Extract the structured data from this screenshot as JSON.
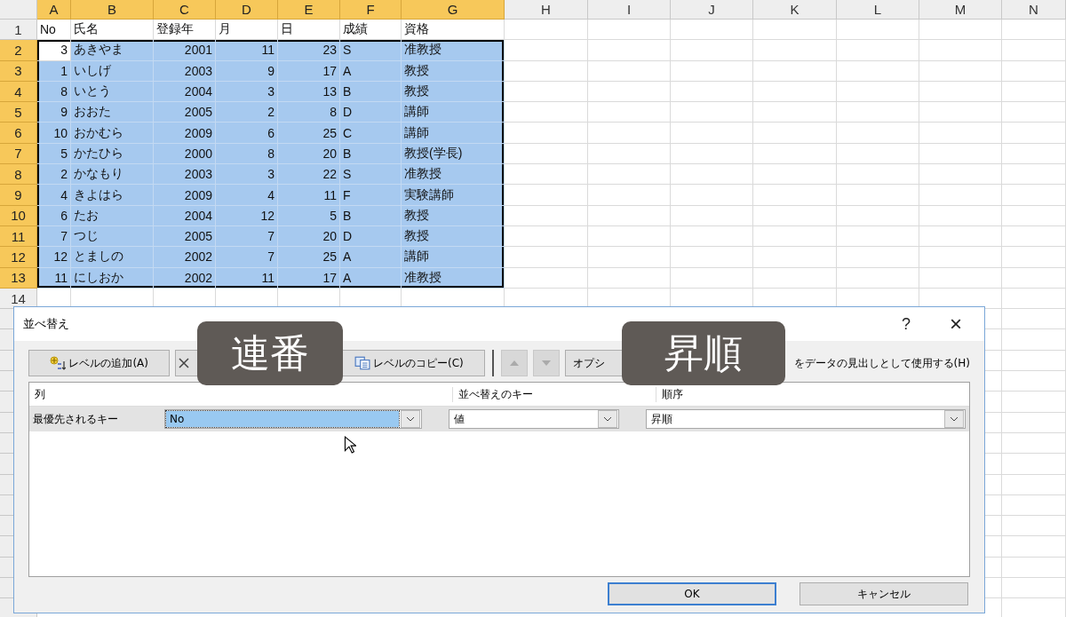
{
  "sheet": {
    "columns": [
      {
        "letter": "A",
        "selected": true,
        "kind": "number"
      },
      {
        "letter": "B",
        "selected": true,
        "kind": "text"
      },
      {
        "letter": "C",
        "selected": true,
        "kind": "number"
      },
      {
        "letter": "D",
        "selected": true,
        "kind": "number"
      },
      {
        "letter": "E",
        "selected": true,
        "kind": "number"
      },
      {
        "letter": "F",
        "selected": true,
        "kind": "text"
      },
      {
        "letter": "G",
        "selected": true,
        "kind": "text"
      },
      {
        "letter": "H",
        "selected": false,
        "kind": "text"
      },
      {
        "letter": "I",
        "selected": false,
        "kind": "text"
      },
      {
        "letter": "J",
        "selected": false,
        "kind": "text"
      },
      {
        "letter": "K",
        "selected": false,
        "kind": "text"
      },
      {
        "letter": "L",
        "selected": false,
        "kind": "text"
      },
      {
        "letter": "M",
        "selected": false,
        "kind": "text"
      },
      {
        "letter": "N",
        "selected": false,
        "kind": "text"
      }
    ],
    "rows": [
      {
        "header": "1",
        "selected": false,
        "kind": "heading",
        "cells": [
          "No",
          "氏名",
          "登録年",
          "月",
          "日",
          "成績",
          "資格"
        ]
      },
      {
        "header": "2",
        "selected": true,
        "active_first_cell": true,
        "cells": [
          "3",
          "あきやま",
          "2001",
          "11",
          "23",
          "S",
          "准教授"
        ]
      },
      {
        "header": "3",
        "selected": true,
        "active_first_cell": false,
        "cells": [
          "1",
          "いしげ",
          "2003",
          "9",
          "17",
          "A",
          "教授"
        ]
      },
      {
        "header": "4",
        "selected": true,
        "active_first_cell": false,
        "cells": [
          "8",
          "いとう",
          "2004",
          "3",
          "13",
          "B",
          "教授"
        ]
      },
      {
        "header": "5",
        "selected": true,
        "active_first_cell": false,
        "cells": [
          "9",
          "おおた",
          "2005",
          "2",
          "8",
          "D",
          "講師"
        ]
      },
      {
        "header": "6",
        "selected": true,
        "active_first_cell": false,
        "cells": [
          "10",
          "おかむら",
          "2009",
          "6",
          "25",
          "C",
          "講師"
        ]
      },
      {
        "header": "7",
        "selected": true,
        "active_first_cell": false,
        "cells": [
          "5",
          "かたひら",
          "2000",
          "8",
          "20",
          "B",
          "教授(学長)"
        ]
      },
      {
        "header": "8",
        "selected": true,
        "active_first_cell": false,
        "cells": [
          "2",
          "かなもり",
          "2003",
          "3",
          "22",
          "S",
          "准教授"
        ]
      },
      {
        "header": "9",
        "selected": true,
        "active_first_cell": false,
        "cells": [
          "4",
          "きよはら",
          "2009",
          "4",
          "11",
          "F",
          "実験講師"
        ]
      },
      {
        "header": "10",
        "selected": true,
        "active_first_cell": false,
        "cells": [
          "6",
          "たお",
          "2004",
          "12",
          "5",
          "B",
          "教授"
        ]
      },
      {
        "header": "11",
        "selected": true,
        "active_first_cell": false,
        "cells": [
          "7",
          "つじ",
          "2005",
          "7",
          "20",
          "D",
          "教授"
        ]
      },
      {
        "header": "12",
        "selected": true,
        "active_first_cell": false,
        "cells": [
          "12",
          "とましの",
          "2002",
          "7",
          "25",
          "A",
          "講師"
        ]
      },
      {
        "header": "13",
        "selected": true,
        "active_first_cell": false,
        "cells": [
          "11",
          "にしおか",
          "2002",
          "11",
          "17",
          "A",
          "准教授"
        ]
      },
      {
        "header": "14",
        "selected": false,
        "cells": []
      }
    ]
  },
  "dialog": {
    "title": "並べ替え",
    "help": "?",
    "close": "×",
    "toolbar": {
      "add_level": "レベルの追加(A)",
      "copy_level": "レベルのコピー(C)",
      "move_up_disabled": true,
      "move_down_disabled": true,
      "options": "オプシ",
      "header_checkbox_label": "をデータの見出しとして使用する(H)"
    },
    "columns": [
      "列",
      "並べ替えのキー",
      "順序"
    ],
    "levels": [
      {
        "label": "最優先されるキー",
        "column": "No",
        "column_focused": true,
        "sort_on": "値",
        "order": "昇順"
      }
    ],
    "buttons": [
      {
        "label": "OK",
        "default": true
      },
      {
        "label": "キャンセル",
        "default": false
      }
    ]
  },
  "captions": [
    {
      "text": "連番"
    },
    {
      "text": "昇順"
    }
  ]
}
